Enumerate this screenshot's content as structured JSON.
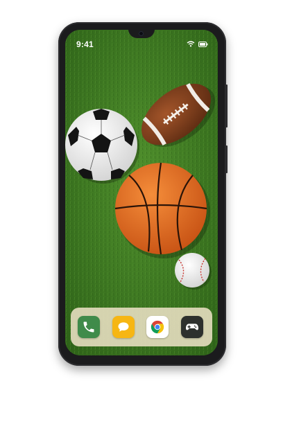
{
  "status_bar": {
    "time": "9:41",
    "icons": [
      "wifi-icon",
      "battery-icon"
    ]
  },
  "wallpaper": {
    "theme": "sports balls on grass",
    "items": [
      "football",
      "soccer-ball",
      "basketball",
      "baseball"
    ]
  },
  "dock": {
    "apps": [
      {
        "name": "phone",
        "icon": "phone-icon",
        "color": "#3f8b4a"
      },
      {
        "name": "messages",
        "icon": "chat-bubble-icon",
        "color": "#f6b613"
      },
      {
        "name": "chrome",
        "icon": "chrome-icon",
        "color": "#ffffff"
      },
      {
        "name": "games",
        "icon": "gamepad-icon",
        "color": "#2d302d"
      }
    ]
  },
  "colors": {
    "grass": "#3f7a22",
    "phone_frame": "#1b1b1d",
    "dock": "#eae0c4"
  }
}
